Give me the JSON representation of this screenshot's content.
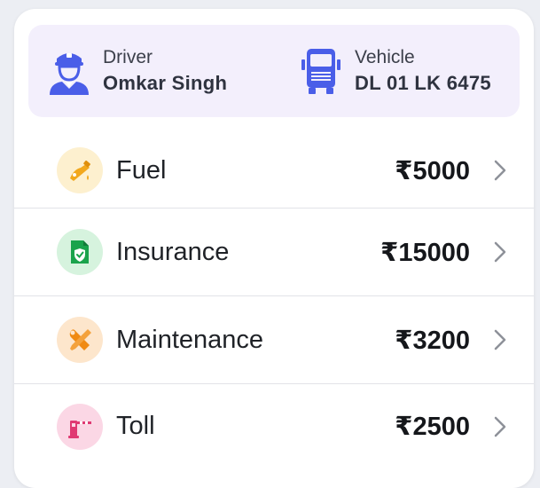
{
  "driver": {
    "label": "Driver",
    "name": "Omkar Singh",
    "icon": "driver-icon"
  },
  "vehicle": {
    "label": "Vehicle",
    "number": "DL 01 LK 6475",
    "icon": "truck-icon"
  },
  "colors": {
    "accent": "#4a5ee8",
    "panel_bg": "#f3effc",
    "fuel_bg": "#fdf0cf",
    "insurance_bg": "#d6f3de",
    "maintenance_bg": "#fde6cc",
    "toll_bg": "#fbd7e5"
  },
  "expenses": [
    {
      "label": "Fuel",
      "amount": "₹5000",
      "icon": "fuel-nozzle-icon"
    },
    {
      "label": "Insurance",
      "amount": "₹15000",
      "icon": "insurance-document-icon"
    },
    {
      "label": "Maintenance",
      "amount": "₹3200",
      "icon": "wrench-screwdriver-icon"
    },
    {
      "label": "Toll",
      "amount": "₹2500",
      "icon": "toll-barrier-icon"
    }
  ]
}
